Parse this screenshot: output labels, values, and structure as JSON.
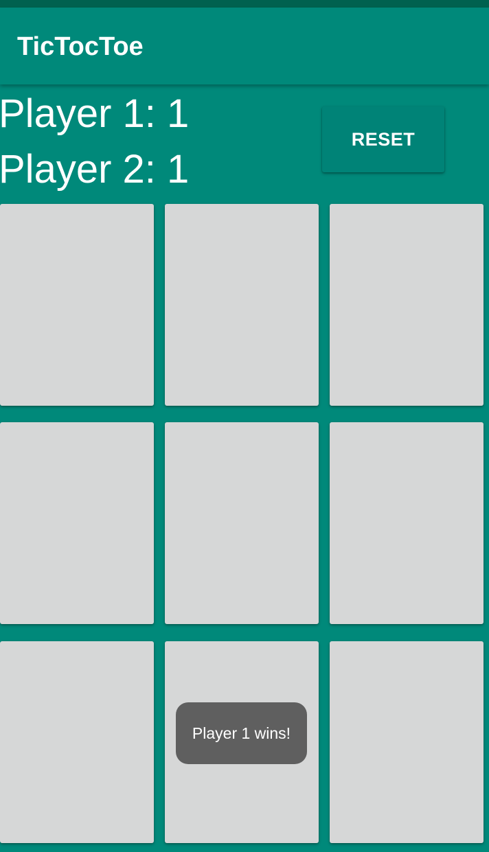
{
  "app": {
    "title": "TicTocToe"
  },
  "scores": {
    "player1": "Player 1: 1",
    "player2": "Player 2: 1"
  },
  "controls": {
    "reset_label": "RESET"
  },
  "board": {
    "cells": [
      "",
      "",
      "",
      "",
      "",
      "",
      "",
      "",
      ""
    ]
  },
  "toast": {
    "message": "Player 1 wins!"
  },
  "colors": {
    "primary": "#00897a",
    "primary_dark": "#00614f",
    "button": "#008377",
    "cell": "#d6d7d7",
    "toast": "#5f5f5f"
  }
}
